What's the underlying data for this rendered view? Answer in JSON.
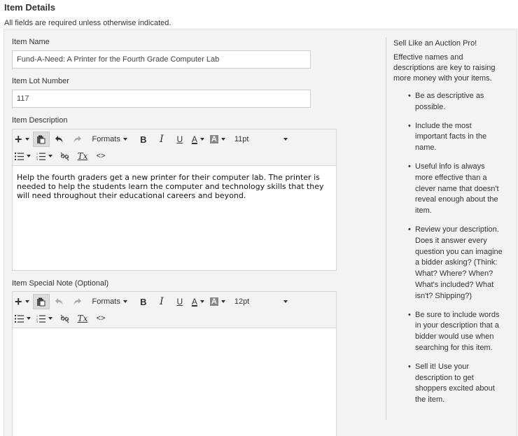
{
  "page": {
    "title": "Item Details",
    "required_note": "All fields are required unless otherwise indicated."
  },
  "form": {
    "item_name": {
      "label": "Item Name",
      "value": "Fund-A-Need: A Printer for the Fourth Grade Computer Lab"
    },
    "lot_number": {
      "label": "Item Lot Number",
      "value": "117"
    },
    "description": {
      "label": "Item Description",
      "font_size": "11pt",
      "text": "Help the fourth graders get a new printer for their computer lab. The printer is needed to help the students learn the computer and technology skills that they will need throughout their educational careers and beyond."
    },
    "special_note": {
      "label": "Item Special Note (Optional)",
      "font_size": "12pt",
      "text": ""
    }
  },
  "toolbar": {
    "formats_label": "Formats",
    "bold_label": "B",
    "italic_label": "I",
    "underline_label": "U",
    "text_color_label": "A",
    "bg_color_label": "A",
    "clear_format_label": "Tx",
    "source_label": "<>",
    "icons": [
      "insert-icon",
      "paste-icon",
      "undo-icon",
      "redo-icon",
      "bullet-list-icon",
      "numbered-list-icon",
      "unlink-icon",
      "clear-format-icon",
      "source-code-icon"
    ]
  },
  "sidebar": {
    "heading": "Sell Like an Auction Pro!",
    "intro": "Effective names and descriptions are key to raising more money with your items.",
    "tips": [
      "Be as descriptive as possible.",
      "Include the most important facts in the name.",
      "Useful info is always more effective than a clever name that doesn't reveal enough about the item.",
      "Review your description. Does it answer every question you can imagine a bidder asking? (Think: What? Where? When? What's included? What isn't? Shipping?)",
      "Be sure to include words in your description that a bidder would use when searching for this item.",
      "Sell it! Use your description to get shoppers excited about the item."
    ]
  },
  "colors": {
    "panel_bg": "#f3f3f3",
    "toolbar_bg": "#f3f3f3",
    "border": "#cccccc",
    "text": "#333333"
  }
}
